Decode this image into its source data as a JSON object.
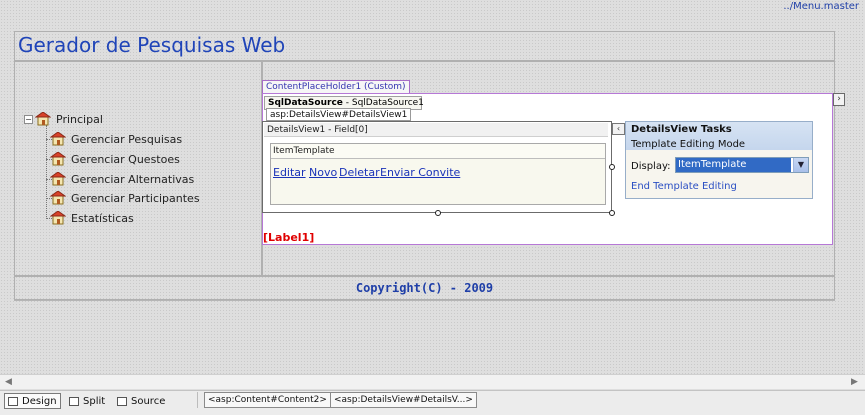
{
  "master_path": "../Menu.master",
  "page": {
    "title": "Gerador de Pesquisas Web",
    "copyright": "Copyright(C) - 2009"
  },
  "tree": {
    "root": "Principal",
    "children": [
      "Gerenciar Pesquisas",
      "Gerenciar Questoes",
      "Gerenciar Alternativas",
      "Gerenciar Participantes",
      "Estatísticas"
    ]
  },
  "designer": {
    "content_placeholder_tab": "ContentPlaceHolder1 (Custom)",
    "sqldatasource_type": "SqlDataSource",
    "sqldatasource_id": " - SqlDataSource1",
    "detailsview_tag": "asp:DetailsView#DetailsView1",
    "detailsview_header": "DetailsView1 - Field[0]",
    "item_template_header": "ItemTemplate",
    "links": [
      "Editar",
      "Novo",
      "Deletar",
      "Enviar Convite"
    ],
    "label1": "[Label1]"
  },
  "tasks_panel": {
    "title": "DetailsView Tasks",
    "subtitle": "Template Editing Mode",
    "display_label": "Display:",
    "display_value": "ItemTemplate",
    "end_link": "End Template Editing"
  },
  "bottom_bar": {
    "views": [
      {
        "label": "Design",
        "active": true
      },
      {
        "label": "Split",
        "active": false
      },
      {
        "label": "Source",
        "active": false
      }
    ],
    "breadcrumbs": [
      "<asp:Content#Content2>",
      "<asp:DetailsView#DetailsV...>"
    ]
  },
  "colors": {
    "title_blue": "#1f44b8",
    "label_red": "#e00000",
    "placeholder_border": "#b678d6",
    "selection_blue": "#316ac5"
  },
  "icons": [
    "tree-collapse-icon",
    "sitemap-page-icon",
    "smart-tag-arrow-icon",
    "dropdown-arrow-icon",
    "chevron-right-icon",
    "design-view-icon",
    "split-view-icon",
    "source-view-icon"
  ]
}
